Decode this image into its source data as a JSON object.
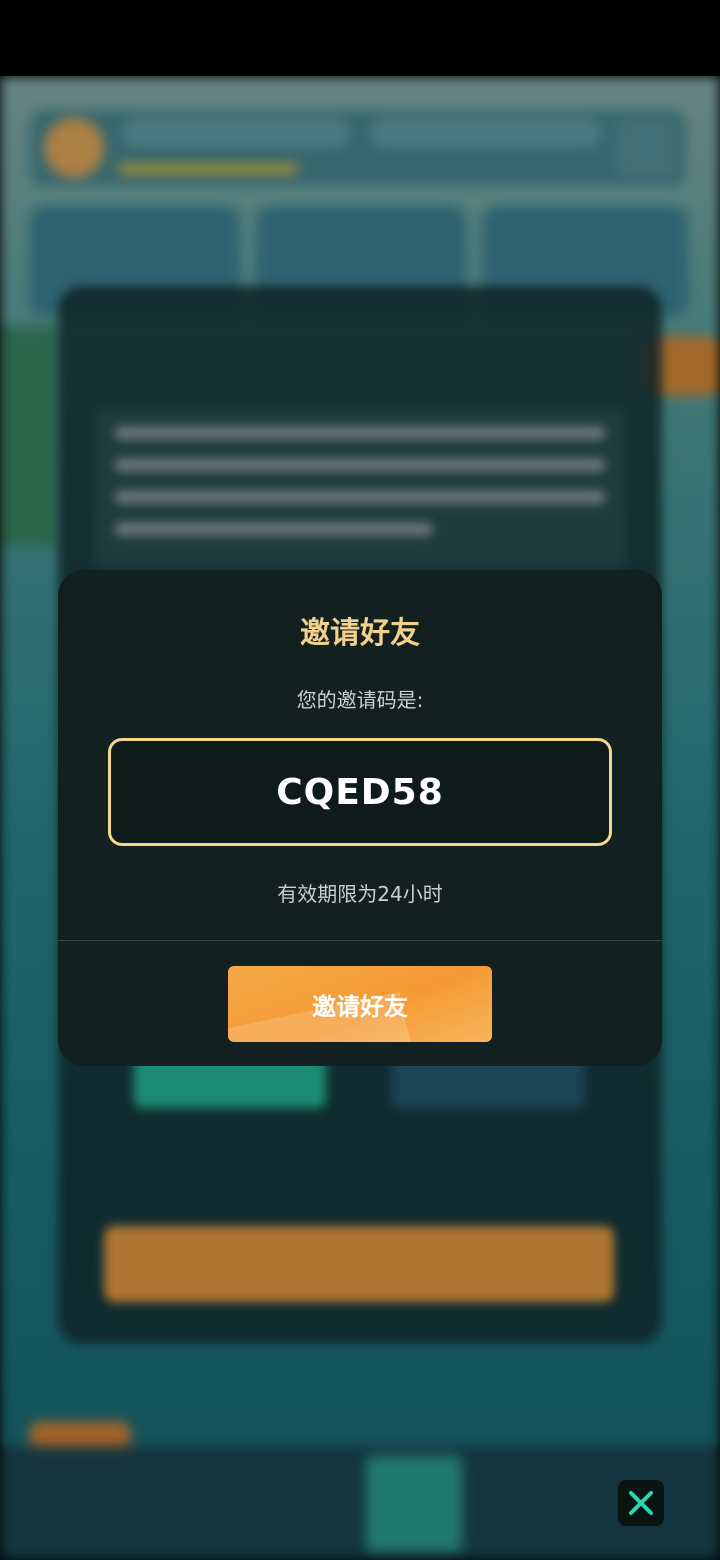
{
  "modal": {
    "title": "邀请好友",
    "subtitle": "您的邀请码是:",
    "code": "CQED58",
    "validity": "有效期限为24小时",
    "button_label": "邀请好友"
  },
  "colors": {
    "title": "#f3d08b",
    "code_border": "#f0d98c",
    "button": "#f4a447",
    "close_icon": "#2fd3b0"
  },
  "icons": {
    "close": "close-icon"
  }
}
